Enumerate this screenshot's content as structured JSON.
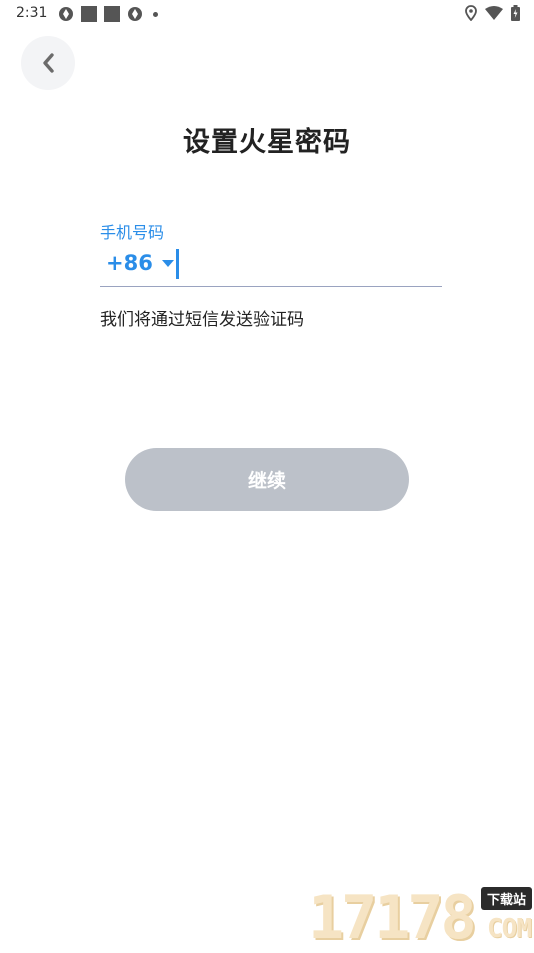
{
  "status_bar": {
    "time": "2:31",
    "left_icons": [
      "aperture-icon",
      "square-icon",
      "square-icon",
      "aperture-icon",
      "dot-icon"
    ],
    "right_icons": [
      "location-icon",
      "wifi-icon",
      "battery-icon"
    ]
  },
  "header": {
    "back_icon": "chevron-left-icon",
    "title": "设置火星密码"
  },
  "form": {
    "phone_label": "手机号码",
    "country_code": "+86",
    "phone_value": "",
    "sms_hint": "我们将通过短信发送验证码"
  },
  "actions": {
    "continue_label": "继续"
  },
  "watermark": {
    "digits": "17178",
    "tag": "下载站",
    "suffix": "COM"
  },
  "colors": {
    "accent": "#2a8de8",
    "button_disabled": "#bcc1c9",
    "title": "#222222"
  }
}
